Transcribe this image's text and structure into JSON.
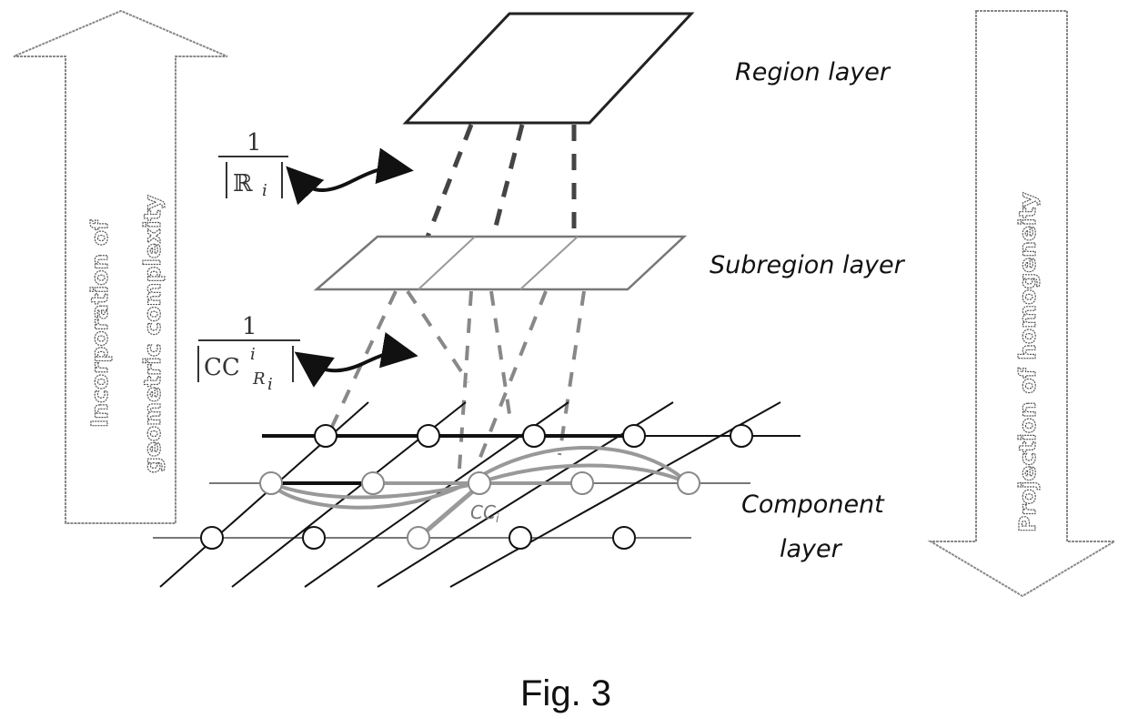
{
  "figure": {
    "caption": "Fig. 3",
    "layers": {
      "region": "Region layer",
      "subregion": "Subregion layer",
      "component_line1": "Component",
      "component_line2": "layer"
    },
    "left_arrow": {
      "direction": "up",
      "line1": "Incorporation of",
      "line2": "geometric complexity"
    },
    "right_arrow": {
      "direction": "down",
      "line1": "Projection of homogeneity"
    },
    "weights": {
      "region_weight": {
        "numerator": "1",
        "denominator_symbol": "ℝ",
        "denominator_subscript": "i"
      },
      "component_weight": {
        "numerator": "1",
        "denominator_symbol": "CC",
        "denominator_superscript": "i",
        "denominator_subscript": "R",
        "denominator_subsubscript": "i"
      }
    },
    "component_label": {
      "base": "CC",
      "subscript": "i"
    }
  }
}
